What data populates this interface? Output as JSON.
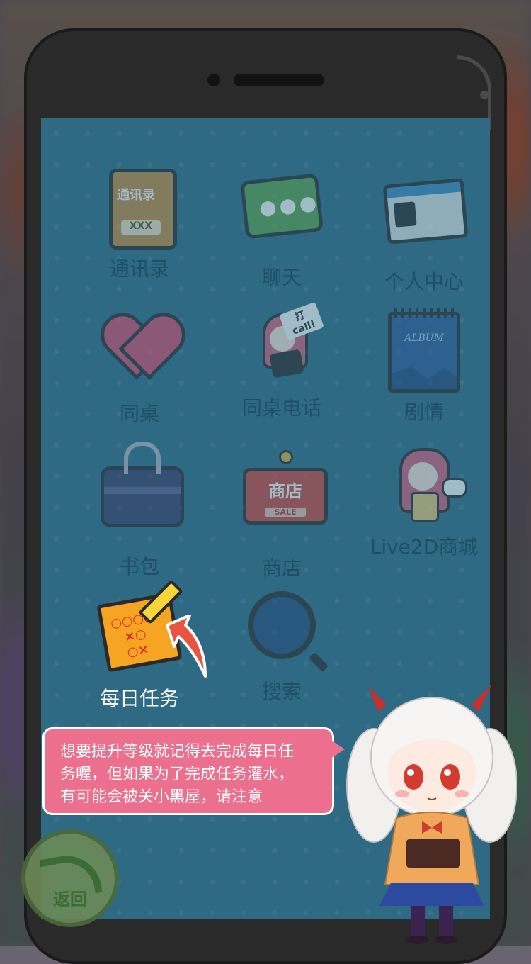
{
  "apps": [
    {
      "label": "通讯录",
      "icon": "contacts-book-icon",
      "icon_text": "通讯录",
      "icon_sub": "XXX"
    },
    {
      "label": "聊天",
      "icon": "chat-bubble-icon"
    },
    {
      "label": "个人中心",
      "icon": "id-card-icon"
    },
    {
      "label": "同桌",
      "icon": "heart-icon"
    },
    {
      "label": "同桌电话",
      "icon": "girl-phone-call-icon",
      "icon_text": "打call!"
    },
    {
      "label": "剧情",
      "icon": "album-icon",
      "icon_text": "ALBUM"
    },
    {
      "label": "书包",
      "icon": "schoolbag-icon"
    },
    {
      "label": "商店",
      "icon": "shop-sign-icon",
      "icon_text": "商店",
      "icon_sub": "SALE"
    },
    {
      "label": "Live2D商城",
      "icon": "chibi-girl-icon"
    },
    {
      "label": "每日任务",
      "icon": "daily-task-list-icon",
      "active": true
    },
    {
      "label": "搜索",
      "icon": "magnifier-icon"
    }
  ],
  "tip": {
    "text_lines": [
      "想要提升等级就记得去完成每日任",
      "务喔，但如果为了完成任务灌水，",
      "有可能会被关小黑屋，请注意"
    ]
  },
  "back_button": {
    "label": "返回"
  },
  "colors": {
    "screen_bg": "#2e6a84",
    "label_dim": "#1f4f65",
    "label_active": "#ffffff",
    "bubble": "#ec6f8e",
    "arrow": "#e8543f"
  }
}
